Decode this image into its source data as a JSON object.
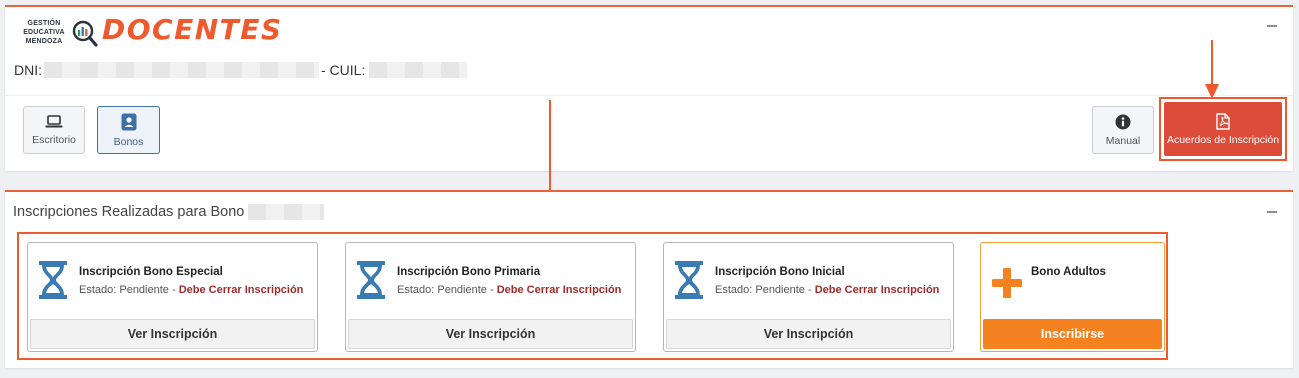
{
  "header": {
    "logo_lines": [
      "GESTIÓN",
      "EDUCATIVA",
      "MENDOZA"
    ],
    "logo_word": "DOCENTES",
    "dni_label": "DNI:",
    "cuil_label": "- CUIL:"
  },
  "toolbar": {
    "escritorio_label": "Escritorio",
    "bonos_label": "Bonos",
    "manual_label": "Manual",
    "acuerdos_label": "Acuerdos de Inscripción"
  },
  "inscripciones": {
    "title": "Inscripciones Realizadas para Bono",
    "cards": [
      {
        "title": "Inscripción Bono Especial",
        "status_prefix": "Estado: Pendiente - ",
        "status_warning": "Debe Cerrar Inscripción",
        "button": "Ver Inscripción"
      },
      {
        "title": "Inscripción Bono Primaria",
        "status_prefix": "Estado: Pendiente - ",
        "status_warning": "Debe Cerrar Inscripción",
        "button": "Ver Inscripción"
      },
      {
        "title": "Inscripción Bono Inicial",
        "status_prefix": "Estado: Pendiente - ",
        "status_warning": "Debe Cerrar Inscripción",
        "button": "Ver Inscripción"
      }
    ],
    "new_card": {
      "title": "Bono Adultos",
      "button": "Inscribirse"
    }
  },
  "colors": {
    "accent": "#ee5a2e",
    "danger_button": "#dd4b39",
    "primary_orange": "#f58220",
    "hourglass": "#3b7bb3",
    "warning_text": "#a02b2b"
  },
  "icons": {
    "escritorio": "laptop-icon",
    "bonos": "id-badge-icon",
    "manual": "info-circle-icon",
    "acuerdos": "pdf-file-icon",
    "card": "hourglass-icon",
    "new": "plus-icon"
  }
}
